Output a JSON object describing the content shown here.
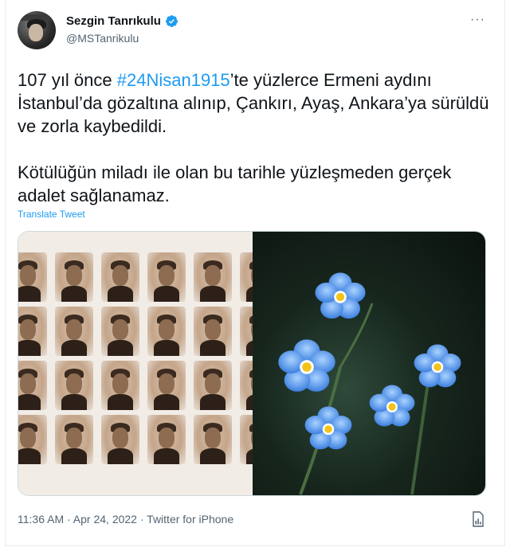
{
  "tweet": {
    "author": {
      "display_name": "Sezgin Tanrıkulu",
      "handle": "@MSTanrikulu",
      "verified": true
    },
    "text": {
      "p1_before": "107 yıl önce ",
      "p1_hashtag": "#24Nisan1915",
      "p1_after": "’te yüzlerce Ermeni aydını İstanbul’da gözaltına alınıp, Çankırı, Ayaş, Ankara’ya sürüldü ve zorla kaybedildi.",
      "p2": "Kötülüğün miladı ile olan bu tarihle yüzleşmeden gerçek adalet sağlanamaz."
    },
    "translate_label": "Translate Tweet",
    "more_label": "···",
    "footer": {
      "time": "11:36 AM",
      "separator1": " · ",
      "date": "Apr 24, 2022",
      "separator2": " · ",
      "source": "Twitter for iPhone"
    }
  },
  "colors": {
    "link": "#1d9bf0",
    "verified_badge": "#1d9bf0",
    "secondary_text": "#536471",
    "flower_petal": "#6aa9f0",
    "flower_center": "#f2c318"
  },
  "icons": [
    "verified-badge-icon",
    "more-options-icon",
    "analytics-icon"
  ]
}
